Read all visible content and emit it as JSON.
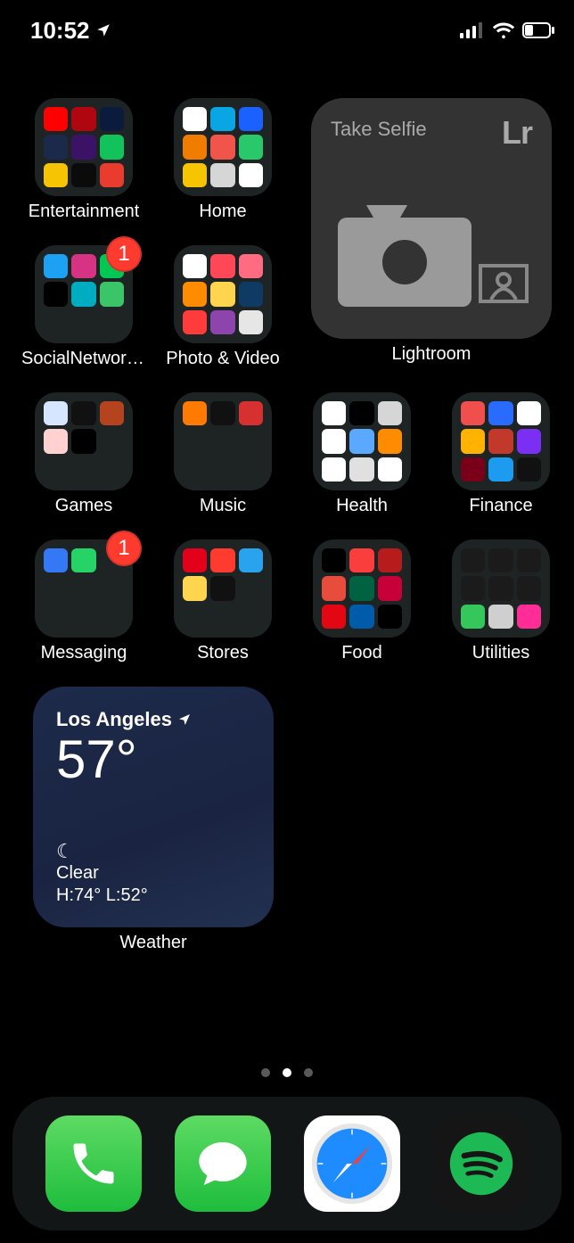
{
  "status": {
    "time": "10:52"
  },
  "folders": {
    "row1": [
      {
        "label": "Entertainment",
        "colors": [
          "#ff0000",
          "#b00610",
          "#0a1b3d",
          "#1b2a4a",
          "#3b1266",
          "#12c25a",
          "#f6c400",
          "#0b0b0b",
          "#e93b2e"
        ]
      },
      {
        "label": "Home",
        "colors": [
          "#fff",
          "#0aa6e3",
          "#1b61ff",
          "#f07c00",
          "#f0544a",
          "#29c96b",
          "#f6c400",
          "#d6d6d6",
          "#fff"
        ]
      }
    ],
    "lightroom": {
      "title": "Take Selfie",
      "logo": "Lr",
      "label": "Lightroom"
    },
    "row2": [
      {
        "label": "SocialNetworki…",
        "badge": "1",
        "colors": [
          "#1da1f2",
          "#d63384",
          "#00c853",
          "#000",
          "#00acc1",
          "#3ac569"
        ]
      },
      {
        "label": "Photo & Video",
        "colors": [
          "#fff",
          "#ff4757",
          "#ff6b81",
          "#ff8c00",
          "#ffd54f",
          "#0f3a63",
          "#ff3b3b",
          "#8e44ad",
          "#e6e6e6"
        ]
      }
    ],
    "row3": [
      {
        "label": "Games",
        "colors": [
          "#d6e6ff",
          "#111",
          "#b4431e",
          "#ffd1d1",
          "#000"
        ]
      },
      {
        "label": "Music",
        "colors": [
          "#ff7a00",
          "#111",
          "#d63031"
        ]
      },
      {
        "label": "Health",
        "colors": [
          "#fff",
          "#000",
          "#d6d6d6",
          "#fff",
          "#5aa9ff",
          "#ff8c00",
          "#fff",
          "#e0e0e0",
          "#fff"
        ]
      },
      {
        "label": "Finance",
        "colors": [
          "#f14e4e",
          "#2a6bff",
          "#fff",
          "#ffb300",
          "#c0392b",
          "#7b2ff2",
          "#7a0019",
          "#1d9bf0",
          "#111"
        ]
      }
    ],
    "row4": [
      {
        "label": "Messaging",
        "badge": "1",
        "colors": [
          "#3478f6",
          "#25d366"
        ]
      },
      {
        "label": "Stores",
        "colors": [
          "#e3001b",
          "#ff3b30",
          "#2aa3ef",
          "#ffd54f",
          "#111"
        ]
      },
      {
        "label": "Food",
        "colors": [
          "#000",
          "#fa3e3e",
          "#b71c1c",
          "#e74c3c",
          "#006241",
          "#c70039",
          "#e30613",
          "#005baa",
          "#000"
        ]
      },
      {
        "label": "Utilities",
        "colors": [
          "#1b1b1b",
          "#1b1b1b",
          "#1b1b1b",
          "#1b1b1b",
          "#1b1b1b",
          "#1b1b1b",
          "#34c759",
          "#cfcfcf",
          "#ff2d95"
        ]
      }
    ]
  },
  "weather": {
    "label": "Weather",
    "location": "Los Angeles",
    "temp": "57°",
    "condition_icon": "☾",
    "condition": "Clear",
    "hilo": "H:74° L:52°"
  },
  "page_dots": {
    "count": 3,
    "active": 1
  },
  "dock": [
    "Phone",
    "Messages",
    "Safari",
    "Spotify"
  ]
}
